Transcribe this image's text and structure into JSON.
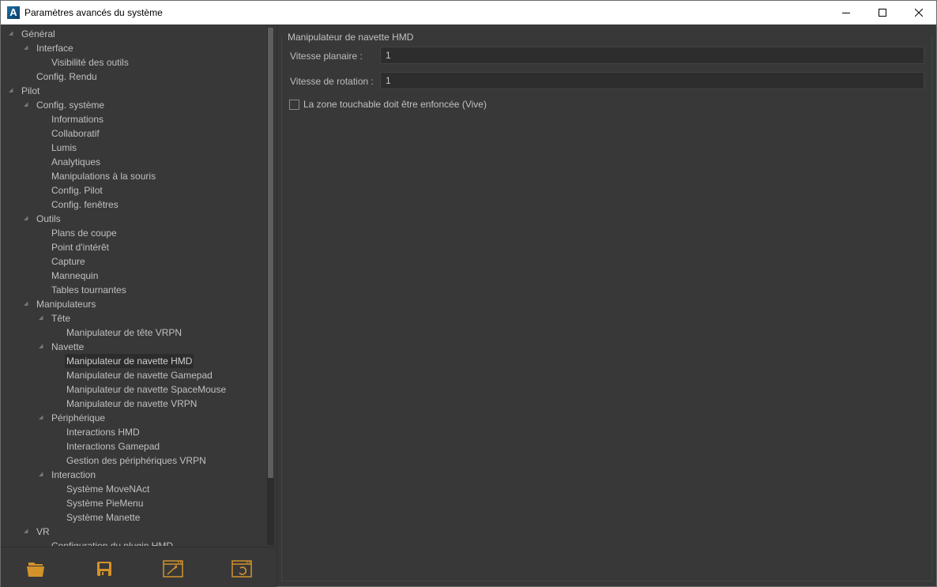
{
  "window": {
    "title": "Paramètres avancés du système",
    "app_icon_glyph": "A",
    "controls": {
      "minimize": "minimize-icon",
      "maximize": "maximize-icon",
      "close": "close-icon"
    }
  },
  "tree": {
    "items": [
      {
        "label": "Général",
        "level": 0,
        "expandable": true
      },
      {
        "label": "Interface",
        "level": 1,
        "expandable": true
      },
      {
        "label": "Visibilité des outils",
        "level": 2,
        "expandable": false
      },
      {
        "label": "Config. Rendu",
        "level": 1,
        "expandable": false
      },
      {
        "label": "Pilot",
        "level": 0,
        "expandable": true
      },
      {
        "label": "Config. système",
        "level": 1,
        "expandable": true
      },
      {
        "label": "Informations",
        "level": 2,
        "expandable": false
      },
      {
        "label": "Collaboratif",
        "level": 2,
        "expandable": false
      },
      {
        "label": "Lumis",
        "level": 2,
        "expandable": false
      },
      {
        "label": "Analytiques",
        "level": 2,
        "expandable": false
      },
      {
        "label": "Manipulations à la souris",
        "level": 2,
        "expandable": false
      },
      {
        "label": "Config. Pilot",
        "level": 2,
        "expandable": false
      },
      {
        "label": "Config. fenêtres",
        "level": 2,
        "expandable": false
      },
      {
        "label": "Outils",
        "level": 1,
        "expandable": true
      },
      {
        "label": "Plans de coupe",
        "level": 2,
        "expandable": false
      },
      {
        "label": "Point d'intérêt",
        "level": 2,
        "expandable": false
      },
      {
        "label": "Capture",
        "level": 2,
        "expandable": false
      },
      {
        "label": "Mannequin",
        "level": 2,
        "expandable": false
      },
      {
        "label": "Tables tournantes",
        "level": 2,
        "expandable": false
      },
      {
        "label": "Manipulateurs",
        "level": 1,
        "expandable": true
      },
      {
        "label": "Tête",
        "level": 2,
        "expandable": true
      },
      {
        "label": "Manipulateur de tête VRPN",
        "level": 3,
        "expandable": false
      },
      {
        "label": "Navette",
        "level": 2,
        "expandable": true
      },
      {
        "label": "Manipulateur de navette HMD",
        "level": 3,
        "expandable": false,
        "selected": true
      },
      {
        "label": "Manipulateur de navette Gamepad",
        "level": 3,
        "expandable": false
      },
      {
        "label": "Manipulateur de navette SpaceMouse",
        "level": 3,
        "expandable": false
      },
      {
        "label": "Manipulateur de navette VRPN",
        "level": 3,
        "expandable": false
      },
      {
        "label": "Périphérique",
        "level": 2,
        "expandable": true
      },
      {
        "label": "Interactions HMD",
        "level": 3,
        "expandable": false
      },
      {
        "label": "Interactions Gamepad",
        "level": 3,
        "expandable": false
      },
      {
        "label": "Gestion des périphériques VRPN",
        "level": 3,
        "expandable": false
      },
      {
        "label": "Interaction",
        "level": 2,
        "expandable": true
      },
      {
        "label": "Système MoveNAct",
        "level": 3,
        "expandable": false
      },
      {
        "label": "Système PieMenu",
        "level": 3,
        "expandable": false
      },
      {
        "label": "Système Manette",
        "level": 3,
        "expandable": false
      },
      {
        "label": "VR",
        "level": 1,
        "expandable": true
      },
      {
        "label": "Configuration du plugin HMD",
        "level": 2,
        "expandable": false
      }
    ],
    "expand_glyph": "◢"
  },
  "toolbar": {
    "accent_color": "#d4922a",
    "buttons": [
      {
        "name": "open-folder",
        "icon": "folder-icon"
      },
      {
        "name": "save",
        "icon": "floppy-disk-icon"
      },
      {
        "name": "reset-defaults",
        "icon": "magic-wand-window-icon"
      },
      {
        "name": "reload",
        "icon": "refresh-window-icon"
      }
    ]
  },
  "panel": {
    "title": "Manipulateur de navette HMD",
    "fields": [
      {
        "label": "Vitesse planaire :",
        "value": "1"
      },
      {
        "label": "Vitesse de rotation :",
        "value": "1"
      }
    ],
    "checkbox": {
      "label": "La zone touchable doit être enfoncée (Vive)",
      "checked": false
    }
  }
}
